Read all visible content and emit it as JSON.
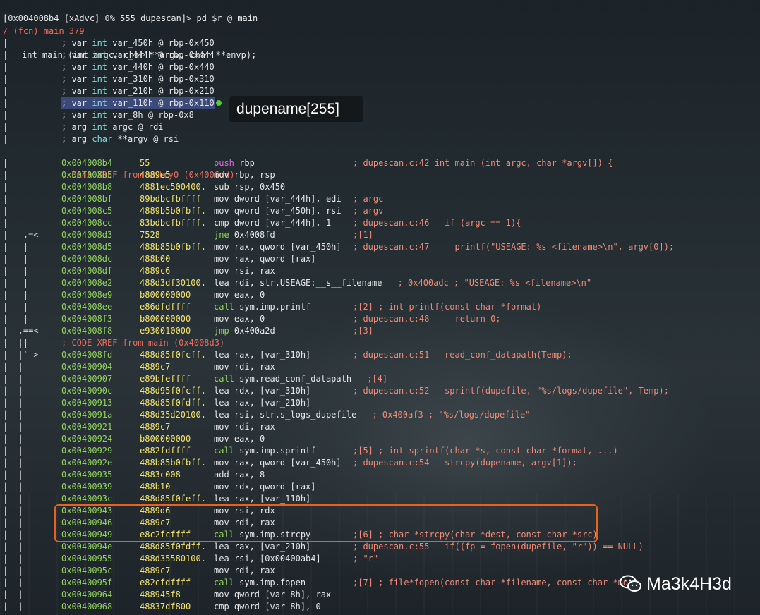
{
  "prompt": "[0x004008b4 [xAdvc] 0% 555 dupescan]> pd $r @ main",
  "fcn_line": "/ (fcn) main 379",
  "signature": "int main (int argc, char **argv, char **envp);",
  "vars": [
    {
      "pre": "; var ",
      "type": "int",
      "rest": " var_450h @ rbp-0x450"
    },
    {
      "pre": "; var ",
      "type": "int",
      "rest": " var_444h @ rbp-0x444"
    },
    {
      "pre": "; var ",
      "type": "int",
      "rest": " var_440h @ rbp-0x440"
    },
    {
      "pre": "; var ",
      "type": "int",
      "rest": " var_310h @ rbp-0x310"
    },
    {
      "pre": "; var ",
      "type": "int",
      "rest": " var_210h @ rbp-0x210"
    },
    {
      "pre": "; var ",
      "type": "int",
      "rest": " var_110h @ rbp-0x110"
    },
    {
      "pre": "; var ",
      "type": "int",
      "rest": " var_8h @ rbp-0x8"
    },
    {
      "pre": "; arg ",
      "type": "int",
      "rest": " argc @ rdi"
    },
    {
      "pre": "; arg ",
      "type": "char",
      "rest": " **argv @ rsi"
    }
  ],
  "xref1": "; DATA XREF from entry0 (0x4006dd)",
  "tooltip": "dupename[255]",
  "instructions": [
    {
      "g": "|  ",
      "addr": "0x004008b4",
      "bytes": "55",
      "mn": "push",
      "mnc": "mag",
      "ops": "rbp",
      "cmt": "; dupescan.c:42 int main (int argc, char *argv[]) {"
    },
    {
      "g": "|  ",
      "addr": "0x004008b5",
      "bytes": "4889e5",
      "mn": "mov",
      "mnc": "white",
      "ops": "rbp, rsp",
      "cmt": ""
    },
    {
      "g": "|  ",
      "addr": "0x004008b8",
      "bytes": "4881ec500400.",
      "mn": "sub",
      "mnc": "white",
      "ops": "rsp, 0x450",
      "cmt": ""
    },
    {
      "g": "|  ",
      "addr": "0x004008bf",
      "bytes": "89bdbcfbffff",
      "mn": "mov",
      "mnc": "white",
      "ops": "dword [var_444h], edi",
      "cmt": "; argc"
    },
    {
      "g": "|  ",
      "addr": "0x004008c5",
      "bytes": "4889b5b0fbff.",
      "mn": "mov",
      "mnc": "white",
      "ops": "qword [var_450h], rsi",
      "cmt": "; argv"
    },
    {
      "g": "|  ",
      "addr": "0x004008cc",
      "bytes": "83bdbcfbffff.",
      "mn": "cmp",
      "mnc": "white",
      "ops": "dword [var_444h], 1",
      "cmt": "; dupescan.c:46   if (argc == 1){"
    },
    {
      "g": "|   ,=<",
      "addr": "0x004008d3",
      "bytes": "7528",
      "mn": "jne",
      "mnc": "green",
      "ops": "0x4008fd",
      "cmt": ";[1]"
    },
    {
      "g": "|   |  ",
      "addr": "0x004008d5",
      "bytes": "488b85b0fbff.",
      "mn": "mov",
      "mnc": "white",
      "ops": "rax, qword [var_450h]",
      "cmt": "; dupescan.c:47     printf(\"USEAGE: %s <filename>\\n\", argv[0]);"
    },
    {
      "g": "|   |  ",
      "addr": "0x004008dc",
      "bytes": "488b00",
      "mn": "mov",
      "mnc": "white",
      "ops": "rax, qword [rax]",
      "cmt": ""
    },
    {
      "g": "|   |  ",
      "addr": "0x004008df",
      "bytes": "4889c6",
      "mn": "mov",
      "mnc": "white",
      "ops": "rsi, rax",
      "cmt": ""
    },
    {
      "g": "|   |  ",
      "addr": "0x004008e2",
      "bytes": "488d3df30100.",
      "mn": "lea",
      "mnc": "white",
      "ops": "rdi, str.USEAGE:__s__filename",
      "cmt": "; 0x400adc ; \"USEAGE: %s <filename>\\n\""
    },
    {
      "g": "|   |  ",
      "addr": "0x004008e9",
      "bytes": "b800000000",
      "mn": "mov",
      "mnc": "white",
      "ops": "eax, 0",
      "cmt": ""
    },
    {
      "g": "|   |  ",
      "addr": "0x004008ee",
      "bytes": "e86dfdffff",
      "mn": "call",
      "mnc": "green",
      "ops": "sym.imp.printf",
      "cmt": ";[2] ; int printf(const char *format)"
    },
    {
      "g": "|   |  ",
      "addr": "0x004008f3",
      "bytes": "b800000000",
      "mn": "mov",
      "mnc": "white",
      "ops": "eax, 0",
      "cmt": "; dupescan.c:48     return 0;"
    },
    {
      "g": "|  ,==<",
      "addr": "0x004008f8",
      "bytes": "e930010000",
      "mn": "jmp",
      "mnc": "green",
      "ops": "0x400a2d",
      "cmt": ";[3]"
    },
    {
      "xref": true,
      "g": "|  ||  ",
      "text": "; CODE XREF from main (0x4008d3)"
    },
    {
      "g": "|  |`->",
      "addr": "0x004008fd",
      "bytes": "488d85f0fcff.",
      "mn": "lea",
      "mnc": "white",
      "ops": "rax, [var_310h]",
      "cmt": "; dupescan.c:51   read_conf_datapath(Temp);"
    },
    {
      "g": "|  |   ",
      "addr": "0x00400904",
      "bytes": "4889c7",
      "mn": "mov",
      "mnc": "white",
      "ops": "rdi, rax",
      "cmt": ""
    },
    {
      "g": "|  |   ",
      "addr": "0x00400907",
      "bytes": "e89bfeffff",
      "mn": "call",
      "mnc": "green",
      "ops": "sym.read_conf_datapath",
      "cmt": ";[4]"
    },
    {
      "g": "|  |   ",
      "addr": "0x0040090c",
      "bytes": "488d95f0fcff.",
      "mn": "lea",
      "mnc": "white",
      "ops": "rdx, [var_310h]",
      "cmt": "; dupescan.c:52   sprintf(dupefile, \"%s/logs/dupefile\", Temp);"
    },
    {
      "g": "|  |   ",
      "addr": "0x00400913",
      "bytes": "488d85f0fdff.",
      "mn": "lea",
      "mnc": "white",
      "ops": "rax, [var_210h]",
      "cmt": ""
    },
    {
      "g": "|  |   ",
      "addr": "0x0040091a",
      "bytes": "488d35d20100.",
      "mn": "lea",
      "mnc": "white",
      "ops": "rsi, str.s_logs_dupefile",
      "cmt": "; 0x400af3 ; \"%s/logs/dupefile\""
    },
    {
      "g": "|  |   ",
      "addr": "0x00400921",
      "bytes": "4889c7",
      "mn": "mov",
      "mnc": "white",
      "ops": "rdi, rax",
      "cmt": ""
    },
    {
      "g": "|  |   ",
      "addr": "0x00400924",
      "bytes": "b800000000",
      "mn": "mov",
      "mnc": "white",
      "ops": "eax, 0",
      "cmt": ""
    },
    {
      "g": "|  |   ",
      "addr": "0x00400929",
      "bytes": "e882fdffff",
      "mn": "call",
      "mnc": "green",
      "ops": "sym.imp.sprintf",
      "cmt": ";[5] ; int sprintf(char *s, const char *format, ...)"
    },
    {
      "g": "|  |   ",
      "addr": "0x0040092e",
      "bytes": "488b85b0fbff.",
      "mn": "mov",
      "mnc": "white",
      "ops": "rax, qword [var_450h]",
      "cmt": "; dupescan.c:54   strcpy(dupename, argv[1]);"
    },
    {
      "g": "|  |   ",
      "addr": "0x00400935",
      "bytes": "4883c008",
      "mn": "add",
      "mnc": "white",
      "ops": "rax, 8",
      "cmt": ""
    },
    {
      "g": "|  |   ",
      "addr": "0x00400939",
      "bytes": "488b10",
      "mn": "mov",
      "mnc": "white",
      "ops": "rdx, qword [rax]",
      "cmt": ""
    },
    {
      "g": "|  |   ",
      "addr": "0x0040093c",
      "bytes": "488d85f0feff.",
      "mn": "lea",
      "mnc": "white",
      "ops": "rax, [var_110h]",
      "cmt": ""
    },
    {
      "g": "|  |   ",
      "addr": "0x00400943",
      "bytes": "4889d6",
      "mn": "mov",
      "mnc": "white",
      "ops": "rsi, rdx",
      "cmt": ""
    },
    {
      "g": "|  |   ",
      "addr": "0x00400946",
      "bytes": "4889c7",
      "mn": "mov",
      "mnc": "white",
      "ops": "rdi, rax",
      "cmt": ""
    },
    {
      "g": "|  |   ",
      "addr": "0x00400949",
      "bytes": "e8c2fcffff",
      "mn": "call",
      "mnc": "green",
      "ops": "sym.imp.strcpy",
      "cmt": ";[6] ; char *strcpy(char *dest, const char *src)"
    },
    {
      "g": "|  |   ",
      "addr": "0x0040094e",
      "bytes": "488d85f0fdff.",
      "mn": "lea",
      "mnc": "white",
      "ops": "rax, [var_210h]",
      "cmt": "; dupescan.c:55   if((fp = fopen(dupefile, \"r\")) == NULL)"
    },
    {
      "g": "|  |   ",
      "addr": "0x00400955",
      "bytes": "488d35580100.",
      "mn": "lea",
      "mnc": "white",
      "ops": "rsi, [0x00400ab4]",
      "cmt": "; \"r\""
    },
    {
      "g": "|  |   ",
      "addr": "0x0040095c",
      "bytes": "4889c7",
      "mn": "mov",
      "mnc": "white",
      "ops": "rdi, rax",
      "cmt": ""
    },
    {
      "g": "|  |   ",
      "addr": "0x0040095f",
      "bytes": "e82cfdffff",
      "mn": "call",
      "mnc": "green",
      "ops": "sym.imp.fopen",
      "cmt": ";[7] ; file*fopen(const char *filename, const char *mo"
    },
    {
      "g": "|  |   ",
      "addr": "0x00400964",
      "bytes": "488945f8",
      "mn": "mov",
      "mnc": "white",
      "ops": "qword [var_8h], rax",
      "cmt": ""
    },
    {
      "g": "|  |   ",
      "addr": "0x00400968",
      "bytes": "48837df800",
      "mn": "cmp",
      "mnc": "white",
      "ops": "qword [var_8h], 0",
      "cmt": ""
    }
  ],
  "watermark": "Ma3k4H3d"
}
